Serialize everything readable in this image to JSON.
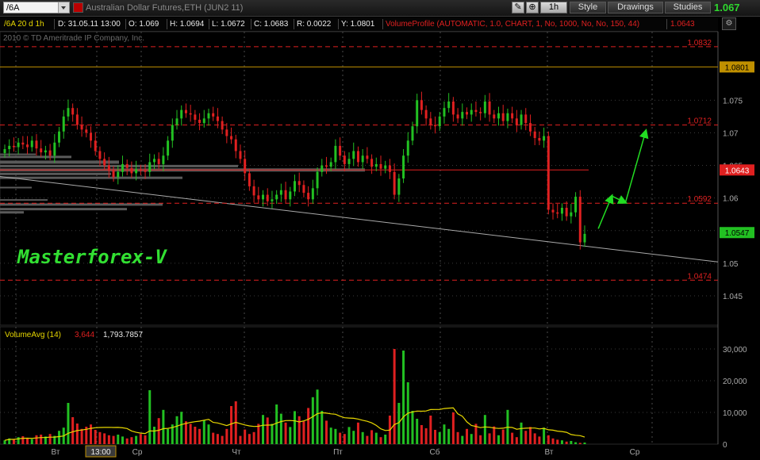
{
  "toolbar": {
    "symbol": "/6A",
    "description": "Australian Dollar Futures,ETH (JUN2 11)",
    "timeframe": "1h",
    "style": "Style",
    "drawings": "Drawings",
    "studies": "Studies",
    "last_price": "1.067"
  },
  "info": {
    "period": "/6A 20 d 1h",
    "date": "D: 31.05.11 13:00",
    "open": "O: 1.069",
    "high": "H: 1.0694",
    "low": "L: 1.0672",
    "close": "C: 1.0683",
    "range": "R: 0.0022",
    "y": "Y: 1.0801",
    "study": "VolumeProfile (AUTOMATIC, 1.0, CHART, 1, No, 1000, No, No, 150, 44)",
    "study_value": "1.0643"
  },
  "copyright": "2010 © TD Ameritrade IP Company, Inc.",
  "watermark": "Masterforex-V",
  "volume_study": {
    "label": "VolumeAvg (14)",
    "value": "3,644",
    "avg": "1,793.7857"
  },
  "colors": {
    "up": "#22c022",
    "down": "#e02020",
    "avg_line": "#e8d800",
    "level": "#e02020",
    "gold": "#c09000",
    "arrow": "#22dd22"
  },
  "chart_data": [
    {
      "type": "candlestick",
      "x_labels": [
        "Вт",
        "13:00",
        "Ср",
        "Чт",
        "Пт",
        "Сб",
        "Вт",
        "Ср"
      ],
      "y_ticks": [
        1.045,
        1.05,
        1.055,
        1.06,
        1.065,
        1.07,
        1.075
      ],
      "y_tick_labels": [
        "1.045",
        "1.05",
        "1.055",
        "1.06",
        "1.065",
        "1.07",
        "1.075"
      ],
      "ylim": [
        1.0405,
        1.0855
      ],
      "levels": [
        {
          "label": "1.0832",
          "value": 1.0832
        },
        {
          "label": "1.0712",
          "value": 1.0712
        },
        {
          "label": "1.0592",
          "value": 1.0592
        },
        {
          "label": "1.0474",
          "value": 1.0474
        }
      ],
      "price_tags": [
        {
          "label": "1.0801",
          "value": 1.0801,
          "kind": "gold"
        },
        {
          "label": "1.0643",
          "value": 1.0643,
          "kind": "red"
        },
        {
          "label": "1.0547",
          "value": 1.0547,
          "kind": "green"
        }
      ],
      "closes": [
        1.0675,
        1.068,
        1.0678,
        1.0685,
        1.0682,
        1.0678,
        1.0688,
        1.0676,
        1.067,
        1.0673,
        1.0665,
        1.0685,
        1.0702,
        1.0725,
        1.0738,
        1.0728,
        1.0712,
        1.0705,
        1.07,
        1.0688,
        1.0672,
        1.066,
        1.065,
        1.0642,
        1.0632,
        1.064,
        1.0652,
        1.0646,
        1.0638,
        1.0644,
        1.0642,
        1.064,
        1.0655,
        1.066,
        1.0652,
        1.0665,
        1.0688,
        1.0712,
        1.0722,
        1.0735,
        1.073,
        1.0728,
        1.072,
        1.0715,
        1.0722,
        1.073,
        1.0725,
        1.0718,
        1.0705,
        1.0695,
        1.069,
        1.0672,
        1.066,
        1.0638,
        1.0618,
        1.0604,
        1.0598,
        1.0605,
        1.0595,
        1.0598,
        1.0605,
        1.0612,
        1.0598,
        1.061,
        1.0626,
        1.062,
        1.0608,
        1.0598,
        1.0615,
        1.064,
        1.065,
        1.0648,
        1.0655,
        1.068,
        1.0665,
        1.0652,
        1.066,
        1.0672,
        1.0655,
        1.0665,
        1.066,
        1.0648,
        1.0652,
        1.0645,
        1.065,
        1.064,
        1.0605,
        1.063,
        1.0665,
        1.0688,
        1.071,
        1.075,
        1.0735,
        1.0722,
        1.0712,
        1.071,
        1.0725,
        1.0738,
        1.0748,
        1.0728,
        1.0722,
        1.0732,
        1.0728,
        1.0735,
        1.0732,
        1.073,
        1.0748,
        1.0728,
        1.0722,
        1.073,
        1.0718,
        1.073,
        1.0722,
        1.0712,
        1.0728,
        1.0715,
        1.0702,
        1.0692,
        1.0688,
        1.0695,
        1.0582,
        1.0578,
        1.0576,
        1.0585,
        1.0572,
        1.0578,
        1.0602,
        1.0532,
        1.0545
      ],
      "volumes": [
        1200,
        1800,
        1500,
        2200,
        2500,
        2000,
        1600,
        2800,
        3000,
        2400,
        3200,
        2600,
        4200,
        5200,
        13000,
        8500,
        6500,
        4800,
        5500,
        6200,
        4500,
        3800,
        3400,
        2800,
        2600,
        3000,
        2400,
        1800,
        2200,
        2600,
        3200,
        2800,
        17000,
        5500,
        8200,
        10800,
        4800,
        6200,
        8800,
        10200,
        7200,
        6400,
        5500,
        4800,
        7600,
        6200,
        3600,
        3200,
        2600,
        4800,
        12000,
        13500,
        2600,
        4600,
        3200,
        3800,
        6400,
        9200,
        8400,
        6400,
        12500,
        9600,
        6800,
        5400,
        10400,
        8800,
        7200,
        11400,
        14800,
        17200,
        10500,
        7400,
        5200,
        4800,
        3600,
        3200,
        5400,
        4200,
        6800,
        3800,
        2600,
        4400,
        3600,
        2200,
        3000,
        9000,
        30000,
        13000,
        29500,
        19500,
        10500,
        8000,
        6000,
        5000,
        9000,
        4500,
        3800,
        6200,
        4800,
        10000,
        3800,
        2600,
        4800,
        3200,
        6400,
        2800,
        9200,
        3400,
        5600,
        2800,
        4600,
        10800,
        3600,
        2200,
        6800,
        4200,
        5400,
        3400,
        2400,
        5200,
        2800,
        1800,
        1400,
        1200,
        800,
        1000,
        600,
        400,
        500
      ],
      "arrows": [
        {
          "from": [
            3,
            1.0553
          ],
          "to": [
            6,
            1.0603
          ]
        },
        {
          "from": [
            6,
            1.0603
          ],
          "to": [
            9,
            1.0593
          ]
        },
        {
          "from": [
            9,
            1.0593
          ],
          "to": [
            13.5,
            1.0703
          ]
        }
      ]
    },
    {
      "type": "bar",
      "title": "VolumeAvg (14)",
      "y_ticks": [
        0,
        10000,
        20000,
        30000
      ],
      "y_tick_labels": [
        "0",
        "10,000",
        "20,000",
        "30,000"
      ],
      "ylim": [
        0,
        32500
      ]
    }
  ]
}
